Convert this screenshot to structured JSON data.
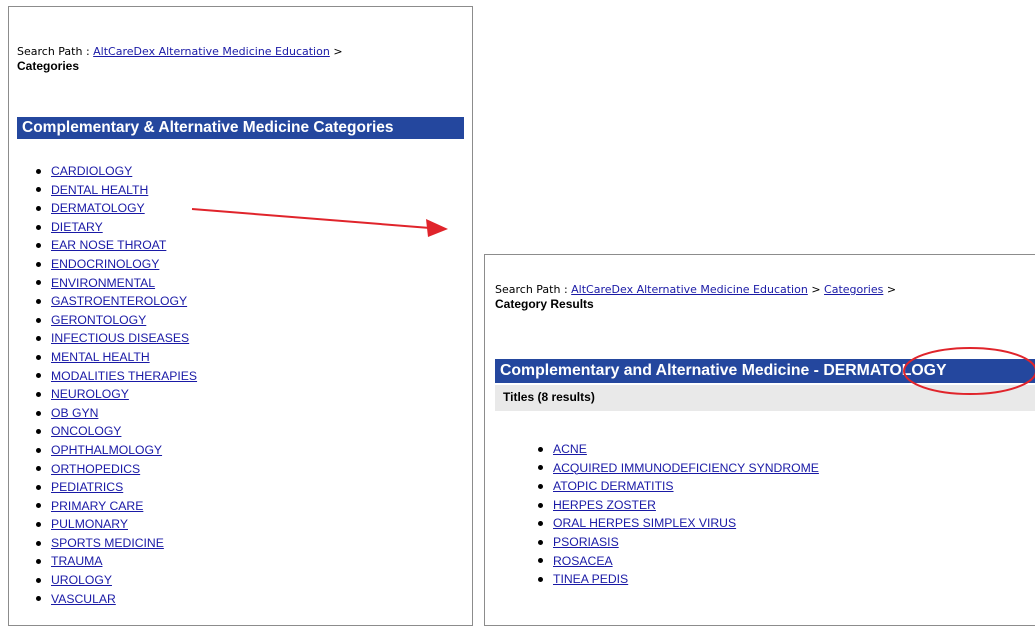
{
  "left_panel": {
    "search_path_label": "Search Path :",
    "search_path_link": "AltCareDex Alternative Medicine Education",
    "search_path_sep": ">",
    "current": "Categories",
    "header": "Complementary & Alternative Medicine Categories",
    "categories": [
      "CARDIOLOGY",
      "DENTAL HEALTH",
      "DERMATOLOGY",
      "DIETARY",
      "EAR NOSE THROAT",
      "ENDOCRINOLOGY",
      "ENVIRONMENTAL",
      "GASTROENTEROLOGY",
      "GERONTOLOGY",
      "INFECTIOUS DISEASES",
      "MENTAL HEALTH",
      "MODALITIES THERAPIES",
      "NEUROLOGY",
      "OB GYN",
      "ONCOLOGY",
      "OPHTHALMOLOGY",
      "ORTHOPEDICS",
      "PEDIATRICS",
      "PRIMARY CARE",
      "PULMONARY",
      "SPORTS MEDICINE",
      "TRAUMA",
      "UROLOGY",
      "VASCULAR"
    ]
  },
  "right_panel": {
    "search_path_label": "Search Path :",
    "search_path_link": "AltCareDex Alternative Medicine Education",
    "search_path_sep": ">",
    "search_path_link2": "Categories",
    "search_path_sep2": ">",
    "current": "Category Results",
    "header_prefix": "Complementary and Alternative Medicine - ",
    "header_category": "DERMATOLOGY",
    "results_label": "Titles (8 results)",
    "titles": [
      "ACNE",
      "ACQUIRED IMMUNODEFICIENCY SYNDROME",
      "ATOPIC DERMATITIS",
      "HERPES ZOSTER",
      "ORAL HERPES SIMPLEX VIRUS",
      "PSORIASIS",
      "ROSACEA",
      "TINEA PEDIS"
    ]
  },
  "colors": {
    "header_bg": "#24479e",
    "link": "#1a1aa6",
    "annotation": "#e0242b"
  }
}
